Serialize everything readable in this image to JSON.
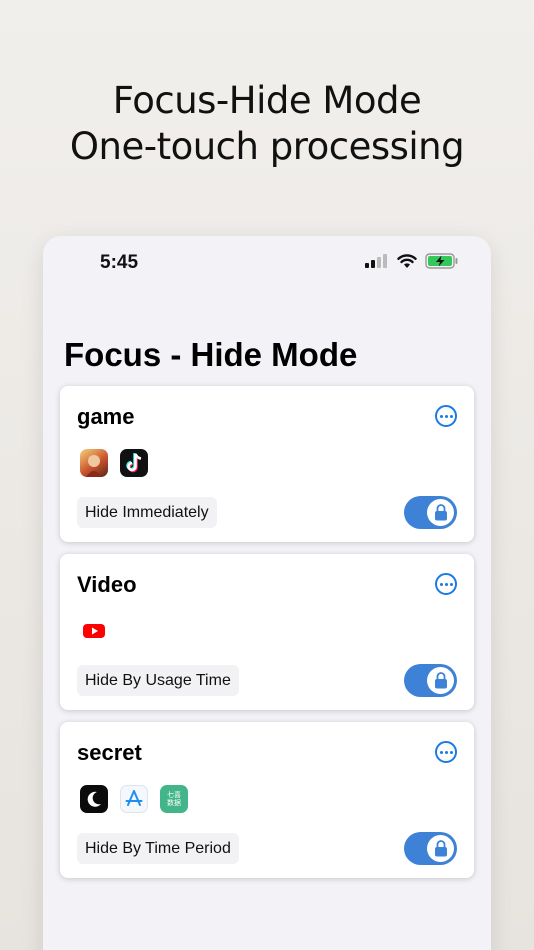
{
  "headline": {
    "line1": "Focus-Hide Mode",
    "line2": "One-touch processing"
  },
  "status": {
    "time": "5:45",
    "icons": [
      "cellular-signal-icon",
      "wifi-icon",
      "battery-charging-icon"
    ]
  },
  "page_title": "Focus - Hide Mode",
  "colors": {
    "accent": "#1a7ae8",
    "toggle_on": "#3e82d8",
    "battery": "#34c759"
  },
  "cards": [
    {
      "title": "game",
      "mode": "Hide Immediately",
      "apps": [
        "game-app-icon",
        "tiktok-app-icon"
      ]
    },
    {
      "title": "Video",
      "mode": "Hide By Usage Time",
      "apps": [
        "youtube-app-icon"
      ]
    },
    {
      "title": "secret",
      "mode": "Hide By Time Period",
      "apps": [
        "moon-app-icon",
        "app-store-icon",
        "qimao-app-icon"
      ]
    }
  ],
  "qimao_icon_text": {
    "top": "七喜",
    "bottom": "数据"
  }
}
